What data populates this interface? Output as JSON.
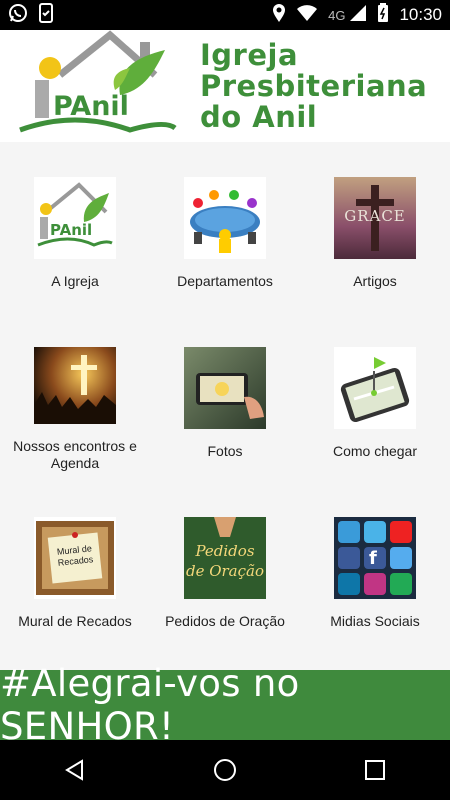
{
  "status_bar": {
    "time": "10:30",
    "network": "4G",
    "icons": [
      "whatsapp-icon",
      "phone-check-icon",
      "location-icon",
      "wifi-icon",
      "signal-icon",
      "battery-icon"
    ]
  },
  "header": {
    "logo_text": "PAnil",
    "title_lines": [
      "Igreja",
      "Presbiteriana",
      "do Anil"
    ]
  },
  "menu": [
    {
      "label": "A Igreja",
      "icon": "church-logo-icon"
    },
    {
      "label": "Departamentos",
      "icon": "meeting-table-icon"
    },
    {
      "label": "Artigos",
      "icon": "cross-grace-icon"
    },
    {
      "label": "Nossos encontros e Agenda",
      "icon": "worship-icon"
    },
    {
      "label": "Fotos",
      "icon": "camera-phone-icon"
    },
    {
      "label": "Como chegar",
      "icon": "map-pin-icon"
    },
    {
      "label": "Mural de Recados",
      "icon": "notice-board-icon"
    },
    {
      "label": "Pedidos de Oração",
      "icon": "praying-hands-icon"
    },
    {
      "label": "Midias Sociais",
      "icon": "social-media-icon"
    }
  ],
  "thumb_texts": {
    "grace": "GRACE",
    "mural": "Mural de Recados",
    "pedidos": "Pedidos de Oração"
  },
  "banner": {
    "text": "#Alegrai-vos no SENHOR!"
  },
  "colors": {
    "brand_green": "#3f8a3d",
    "status_black": "#000000"
  }
}
